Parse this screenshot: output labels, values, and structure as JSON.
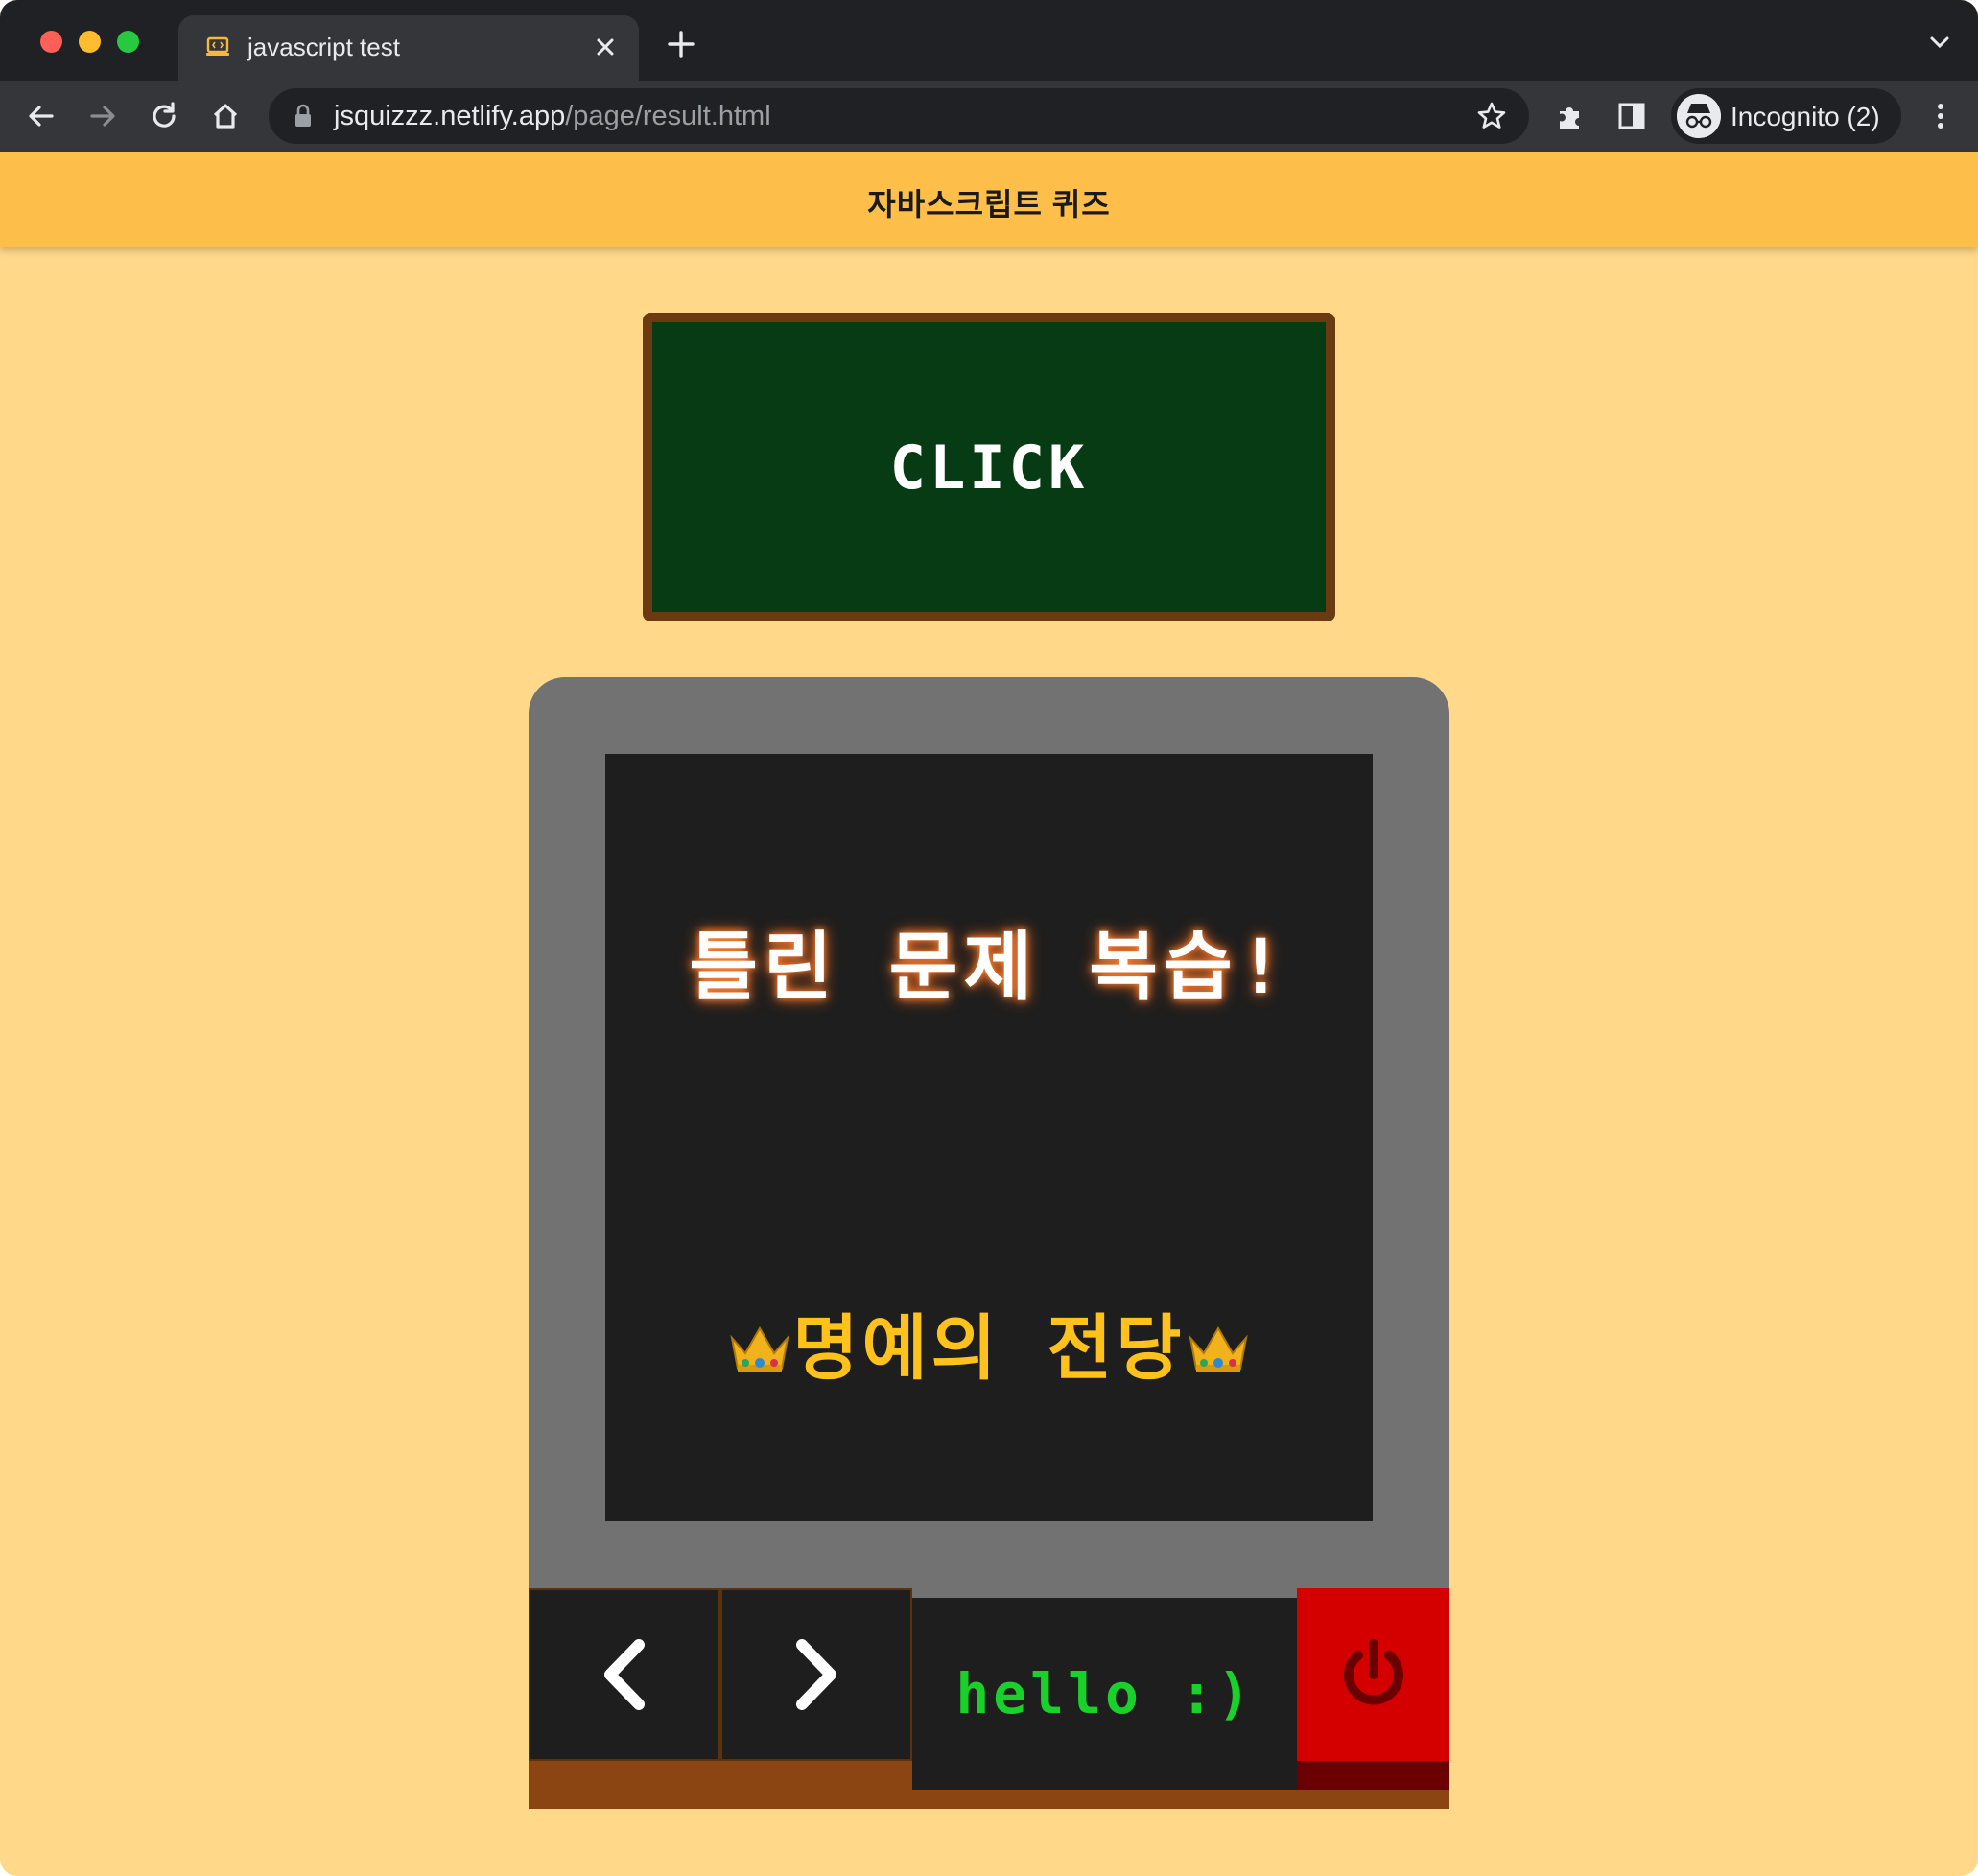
{
  "browser": {
    "tab": {
      "title": "javascript test",
      "favicon": "code-laptop-icon",
      "close_icon": "close-icon"
    },
    "toolbar": {
      "url_host": "jsquizzz.netlify.app",
      "url_path": "/page/result.html",
      "profile_label": "Incognito (2)",
      "icons": [
        "back-icon",
        "forward-icon",
        "reload-icon",
        "home-icon",
        "lock-icon",
        "star-icon",
        "extensions-icon",
        "side-panel-icon",
        "incognito-icon",
        "more-icon"
      ]
    }
  },
  "header": {
    "title": "자바스크립트 퀴즈"
  },
  "board": {
    "label": "CLICK"
  },
  "screen": {
    "title": "틀린 문제 복습!",
    "hall_of_fame": "명예의 전당"
  },
  "controls": {
    "display_text": "hello :)",
    "icons": [
      "chevron-left-icon",
      "chevron-right-icon",
      "power-icon"
    ]
  },
  "colors": {
    "page_bg": "#ffd88a",
    "header_bg": "#fdbf4a",
    "board_bg": "#063b13",
    "board_frame": "#6b3a10",
    "device_body": "#727272",
    "screen_bg": "#1e1e1e",
    "hall_text": "#ffc21c",
    "hello_text": "#19d12a",
    "power_bg": "#d40000"
  }
}
